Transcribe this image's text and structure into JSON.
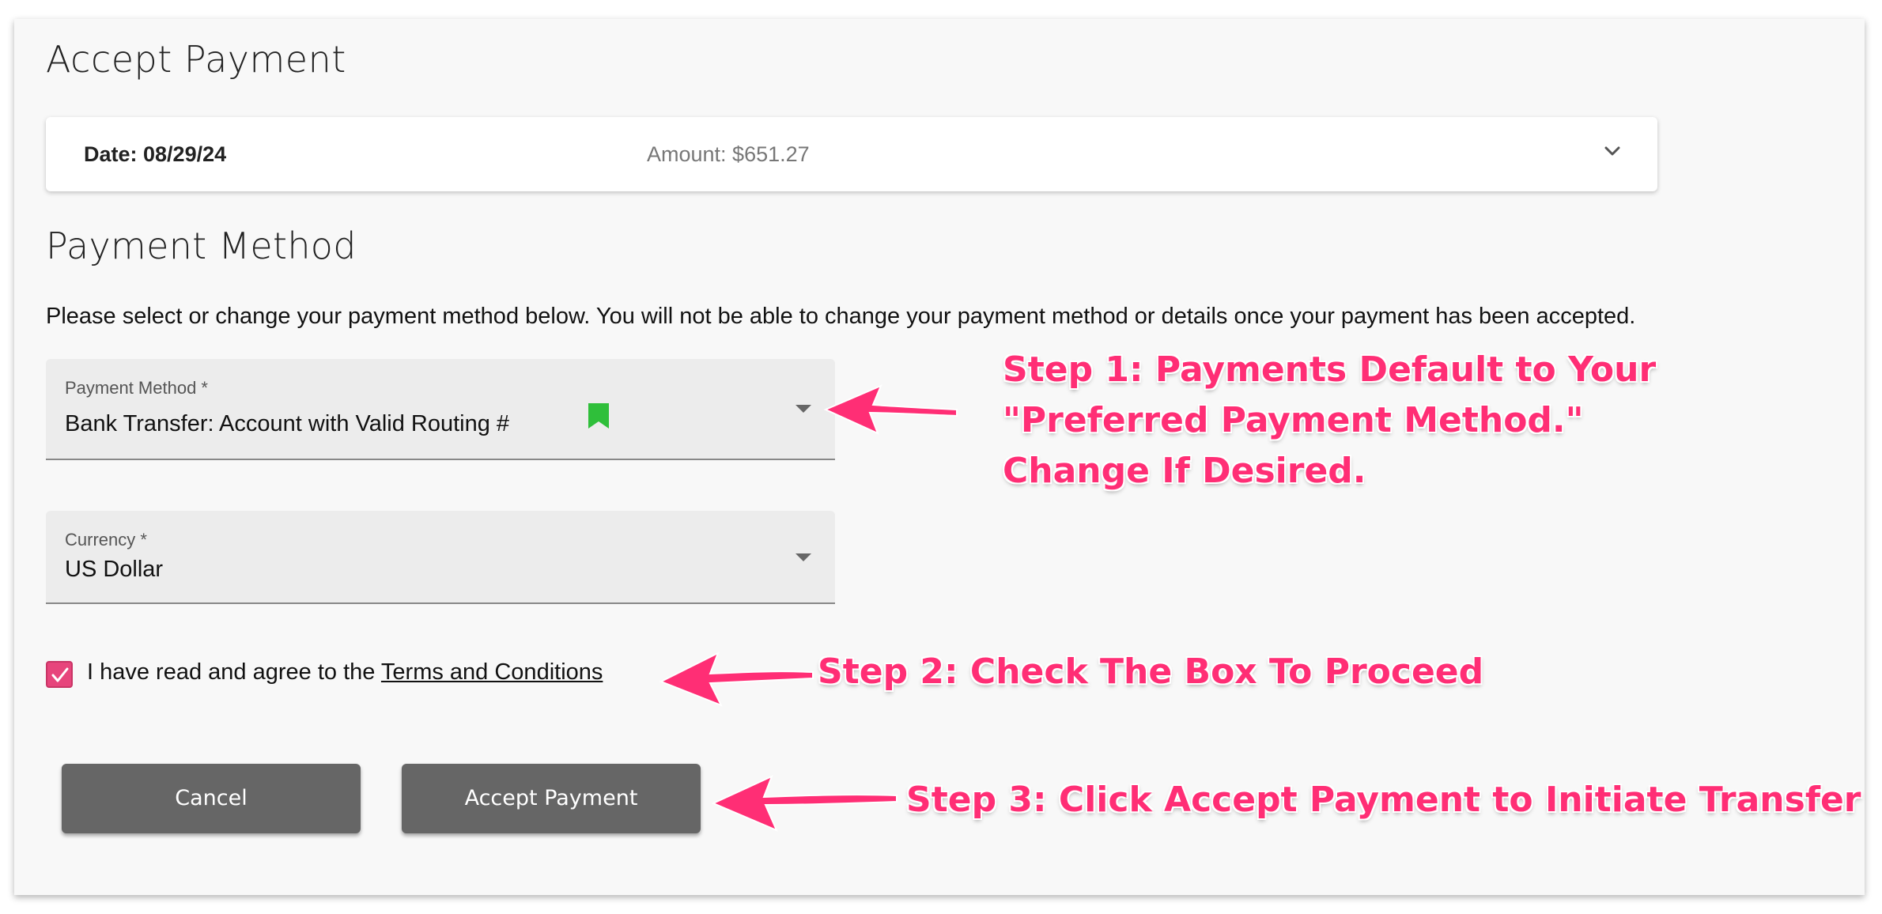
{
  "page": {
    "title": "Accept Payment"
  },
  "summary": {
    "date": "Date: 08/29/24",
    "amount": "Amount: $651.27",
    "expand_icon": "chevron-down-icon"
  },
  "payment_method": {
    "section_title": "Payment Method",
    "instructions": "Please select or change your payment method below. You will not be able to change your payment method or details once your payment has been accepted.",
    "method_field": {
      "label": "Payment Method *",
      "value": "Bank Transfer: Account with Valid Routing #",
      "badge_icon": "bookmark-icon",
      "badge_color": "#2fbf3a"
    },
    "currency_field": {
      "label": "Currency *",
      "value": "US Dollar"
    }
  },
  "agreement": {
    "checked": true,
    "text": "I have read and agree to the ",
    "link": "Terms and Conditions",
    "checkbox_color": "#e7457c"
  },
  "buttons": {
    "cancel": "Cancel",
    "accept": "Accept Payment"
  },
  "annotations": {
    "step1_line1": "Step 1: Payments Default to Your",
    "step1_line2": "\"Preferred Payment Method.\"",
    "step1_line3": "Change If Desired.",
    "step2": "Step 2: Check The Box To Proceed",
    "step3": "Step 3: Click Accept Payment to Initiate Transfer",
    "color": "#ff2e75"
  }
}
